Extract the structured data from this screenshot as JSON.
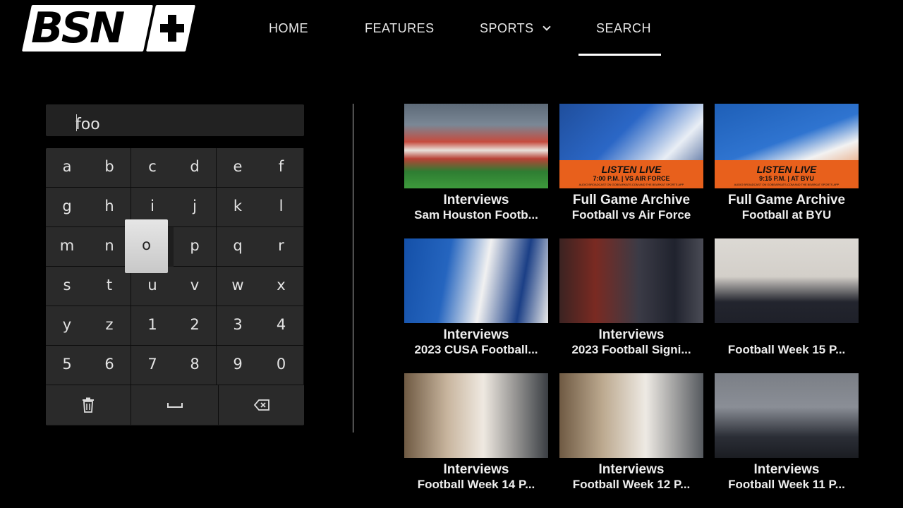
{
  "logo": {
    "text": "BSN"
  },
  "nav": {
    "items": [
      {
        "label": "HOME"
      },
      {
        "label": "FEATURES"
      },
      {
        "label": "SPORTS"
      },
      {
        "label": "SEARCH"
      }
    ],
    "active": "SEARCH"
  },
  "search": {
    "value": "foo"
  },
  "keyboard": {
    "keys": [
      "a",
      "b",
      "c",
      "d",
      "e",
      "f",
      "g",
      "h",
      "i",
      "j",
      "k",
      "l",
      "m",
      "n",
      "o",
      "p",
      "q",
      "r",
      "s",
      "t",
      "u",
      "v",
      "w",
      "x",
      "y",
      "z",
      "1",
      "2",
      "3",
      "4",
      "5",
      "6",
      "7",
      "8",
      "9",
      "0"
    ],
    "selected": "o",
    "function_keys": [
      "trash-icon",
      "space-icon",
      "backspace-icon"
    ]
  },
  "results": [
    {
      "title": "Interviews",
      "subtitle": "Sam Houston Footb..."
    },
    {
      "title": "Full Game Archive",
      "subtitle": "Football vs Air Force",
      "banner": {
        "headline": "LISTEN LIVE",
        "detail": "7:00 P.M. | VS AIR FORCE",
        "fine": "AUDIO BROADCAST ON GOBEARKATS.COM AND THE BEARKAT SPORTS APP"
      }
    },
    {
      "title": "Full Game Archive",
      "subtitle": "Football at BYU",
      "banner": {
        "headline": "LISTEN LIVE",
        "detail": "9:15 P.M. | AT BYU",
        "fine": "AUDIO BROADCAST ON GOBEARKATS.COM AND THE BEARKAT SPORTS APP"
      }
    },
    {
      "title": "Interviews",
      "subtitle": "2023 CUSA Football..."
    },
    {
      "title": "Interviews",
      "subtitle": "2023 Football Signi..."
    },
    {
      "title": "",
      "subtitle": "Football Week 15 P..."
    },
    {
      "title": "Interviews",
      "subtitle": "Football Week 14 P..."
    },
    {
      "title": "Interviews",
      "subtitle": "Football Week 12 P..."
    },
    {
      "title": "Interviews",
      "subtitle": "Football Week 11 P..."
    }
  ],
  "colors": {
    "accent": "#e8601c",
    "background": "#000000",
    "key": "#2a2a2a",
    "key_selected": "#d8d8d8"
  }
}
